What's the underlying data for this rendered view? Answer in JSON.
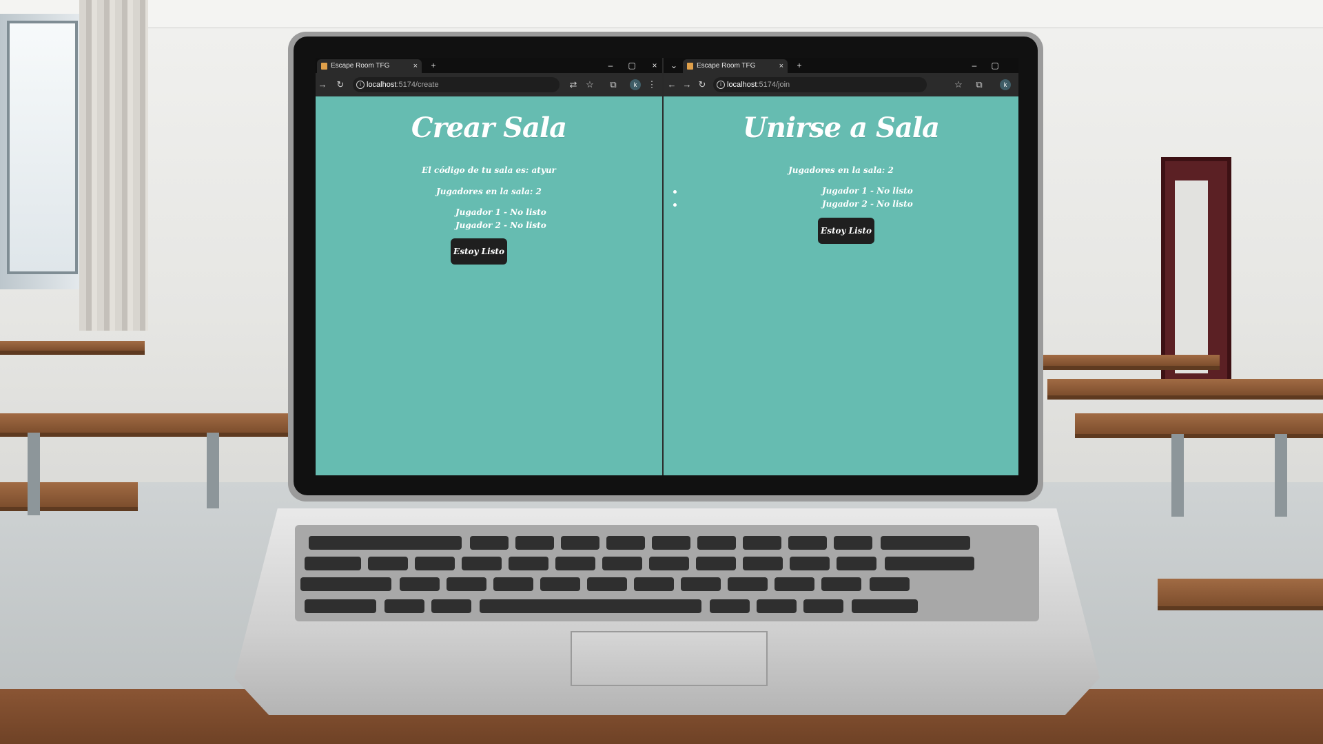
{
  "left_window": {
    "tab_title": "Escape Room TFG",
    "url_host": "localhost",
    "url_path": ":5174/create",
    "avatar_letter": "k",
    "heading": "Crear Sala",
    "room_code_text": "El código de tu sala es: atyur",
    "players_count_text": "Jugadores en la sala: 2",
    "players": [
      "Jugador 1 - No listo",
      "Jugador 2 - No listo"
    ],
    "ready_button": "Estoy Listo"
  },
  "right_window": {
    "tab_title": "Escape Room TFG",
    "url_host": "localhost",
    "url_path": ":5174/join",
    "avatar_letter": "k",
    "heading": "Unirse a Sala",
    "players_count_text": "Jugadores en la sala: 2",
    "players": [
      "Jugador 1 - No listo",
      "Jugador 2 - No listo"
    ],
    "ready_button": "Estoy Listo"
  },
  "icons": {
    "close": "×",
    "plus": "+",
    "minimize": "–",
    "maximize": "▢",
    "back": "←",
    "forward": "→",
    "reload": "↻",
    "star": "☆",
    "menu": "⋮",
    "extensions": "⧉",
    "translate": "⇄",
    "chevron": "⌄"
  },
  "colors": {
    "page_bg": "#66bcb1",
    "button_bg": "#1f1f1f",
    "text": "#ffffff"
  }
}
